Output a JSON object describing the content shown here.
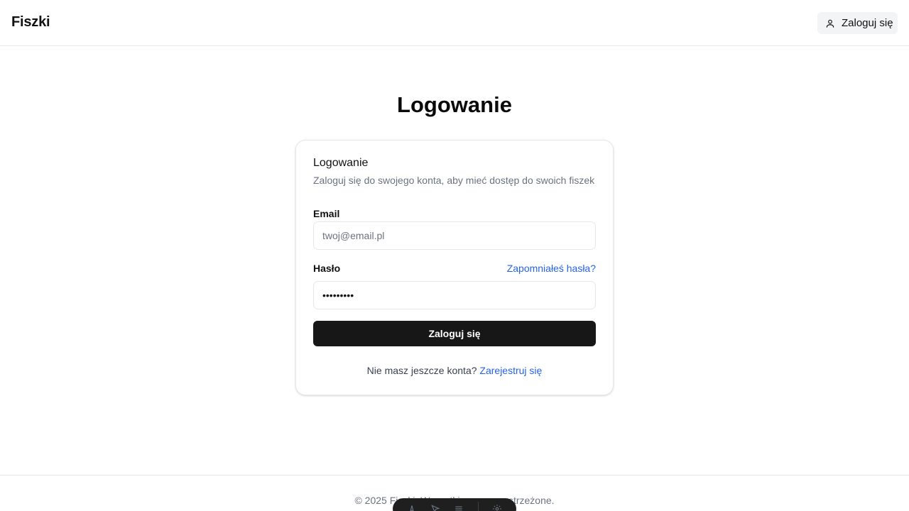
{
  "header": {
    "brand": "Fiszki",
    "login_button": "Zaloguj się",
    "login_icon": "user-icon"
  },
  "page": {
    "title": "Logowanie"
  },
  "card": {
    "title": "Logowanie",
    "description": "Zaloguj się do swojego konta, aby mieć dostęp do swoich fiszek",
    "email_label": "Email",
    "email_placeholder": "twoj@email.pl",
    "email_value": "",
    "password_label": "Hasło",
    "password_value": "•••••••••",
    "forgot_link": "Zapomniałeś hasła?",
    "submit_label": "Zaloguj się",
    "signup_prompt": "Nie masz jeszcze konta?",
    "signup_link": "Zarejestruj się"
  },
  "footer": {
    "text": "© 2025 Fiszki. Wszystkie prawa zastrzeżone."
  },
  "devtools": {
    "icons": [
      "astro-icon",
      "inspect-icon",
      "menu-icon",
      "settings-icon"
    ]
  },
  "colors": {
    "link": "#2563eb",
    "primary_button": "#171717",
    "border": "#e5e7eb"
  }
}
